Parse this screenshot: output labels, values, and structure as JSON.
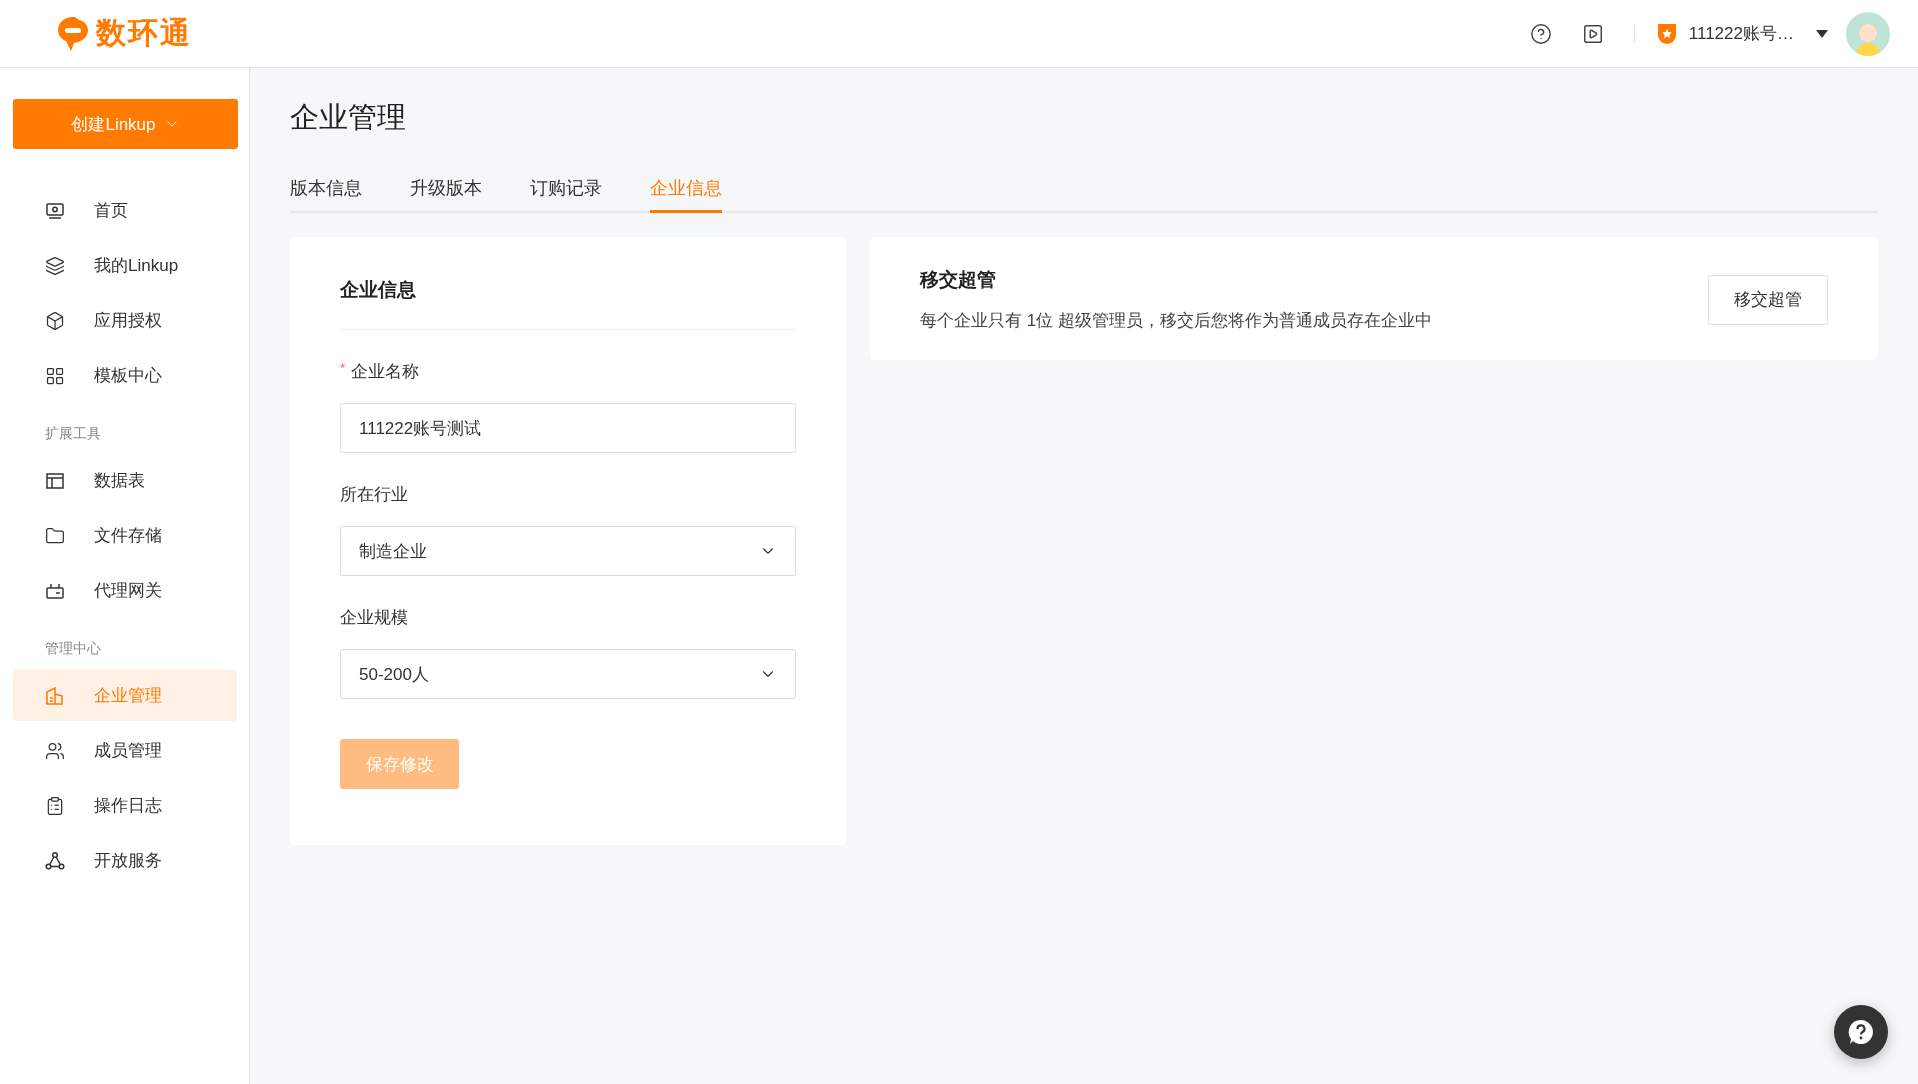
{
  "header": {
    "logo_text": "数环通",
    "account_name": "111222账号…"
  },
  "sidebar": {
    "create_button": "创建Linkup",
    "items": [
      {
        "kind": "item",
        "label": "首页",
        "selected": false
      },
      {
        "kind": "item",
        "label": "我的Linkup",
        "selected": false
      },
      {
        "kind": "item",
        "label": "应用授权",
        "selected": false
      },
      {
        "kind": "item",
        "label": "模板中心",
        "selected": false
      },
      {
        "kind": "section",
        "label": "扩展工具"
      },
      {
        "kind": "item",
        "label": "数据表",
        "selected": false
      },
      {
        "kind": "item",
        "label": "文件存储",
        "selected": false
      },
      {
        "kind": "item",
        "label": "代理网关",
        "selected": false
      },
      {
        "kind": "section",
        "label": "管理中心"
      },
      {
        "kind": "item",
        "label": "企业管理",
        "selected": true
      },
      {
        "kind": "item",
        "label": "成员管理",
        "selected": false
      },
      {
        "kind": "item",
        "label": "操作日志",
        "selected": false
      },
      {
        "kind": "item",
        "label": "开放服务",
        "selected": false
      }
    ]
  },
  "page": {
    "title": "企业管理",
    "tabs": [
      {
        "label": "版本信息",
        "selected": false
      },
      {
        "label": "升级版本",
        "selected": false
      },
      {
        "label": "订购记录",
        "selected": false
      },
      {
        "label": "企业信息",
        "selected": true
      }
    ],
    "info_card": {
      "title": "企业信息",
      "fields": [
        {
          "kind": "input",
          "label": "企业名称",
          "required_mark": "*",
          "value": "111222账号测试"
        },
        {
          "kind": "select",
          "label": "所在行业",
          "value": "制造企业"
        },
        {
          "kind": "select",
          "label": "企业规模",
          "value": "50-200人"
        }
      ],
      "save_button": {
        "label": "保存修改",
        "disabled": true
      }
    },
    "transfer_card": {
      "title": "移交超管",
      "description": "每个企业只有 1位 超级管理员，移交后您将作为普通成员存在企业中",
      "button": "移交超管"
    }
  }
}
